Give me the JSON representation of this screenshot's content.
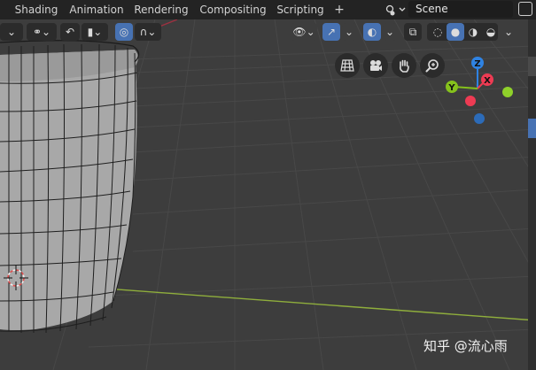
{
  "workspace_tabs": [
    {
      "label": "Shading"
    },
    {
      "label": "Animation"
    },
    {
      "label": "Rendering"
    },
    {
      "label": "Compositing"
    },
    {
      "label": "Scripting"
    }
  ],
  "add_tab_label": "+",
  "scene": {
    "name": "Scene",
    "icon": "scene-icon"
  },
  "viewport_header": {
    "icons": [
      "chevron-down-icon",
      "link-icon",
      "snap-icon",
      "falloff-icon",
      "proportional-edit-icon",
      "visibility-eye-icon",
      "gizmo-icon",
      "overlay-icon",
      "xray-icon",
      "shading-wireframe-icon",
      "shading-solid-icon",
      "shading-material-icon",
      "shading-rendered-icon"
    ],
    "active_shading": "solid"
  },
  "navigation": {
    "icons": [
      "grid-view-icon",
      "camera-icon",
      "hand-pan-icon",
      "zoom-icon"
    ]
  },
  "gizmo": {
    "axes": [
      {
        "label": "Z",
        "color": "#2f83e3"
      },
      {
        "label": "X",
        "color": "#ee3b53"
      },
      {
        "label": "Y",
        "color": "#85c11c"
      }
    ]
  },
  "watermark": "知乎 @流心雨",
  "colors": {
    "viewport_bg": "#3d3d3d",
    "grid_line": "#4a4a4a",
    "x_axis_line": "#9fbf47",
    "accent_blue": "#4772b3"
  }
}
